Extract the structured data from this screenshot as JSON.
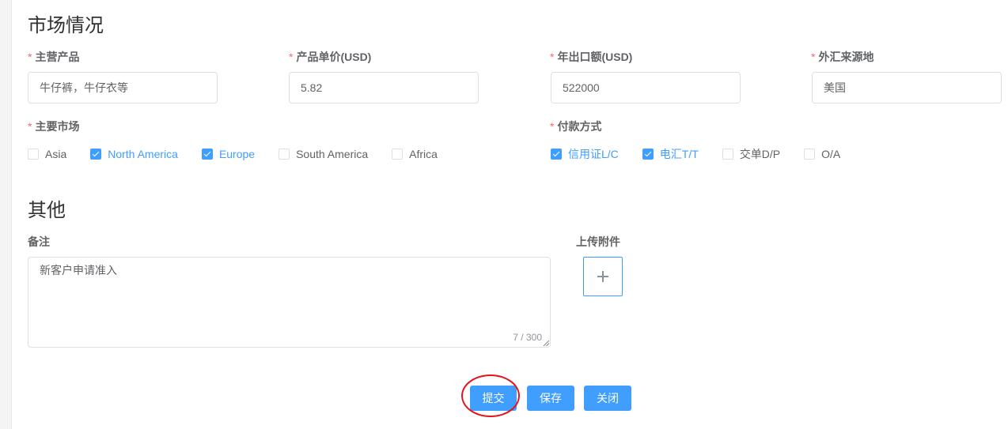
{
  "market": {
    "title": "市场情况",
    "main_product": {
      "label": "主营产品",
      "value": "牛仔裤，牛仔衣等"
    },
    "unit_price": {
      "label": "产品单价(USD)",
      "value": "5.82"
    },
    "annual_export": {
      "label": "年出口额(USD)",
      "value": "522000"
    },
    "fx_source": {
      "label": "外汇来源地",
      "value": "美国"
    },
    "main_markets": {
      "label": "主要市场",
      "options": [
        {
          "label": "Asia",
          "checked": false
        },
        {
          "label": "North America",
          "checked": true
        },
        {
          "label": "Europe",
          "checked": true
        },
        {
          "label": "South America",
          "checked": false
        },
        {
          "label": "Africa",
          "checked": false
        }
      ]
    },
    "payment_methods": {
      "label": "付款方式",
      "options": [
        {
          "label": "信用证L/C",
          "checked": true
        },
        {
          "label": "电汇T/T",
          "checked": true
        },
        {
          "label": "交单D/P",
          "checked": false
        },
        {
          "label": "O/A",
          "checked": false
        }
      ]
    }
  },
  "other": {
    "title": "其他",
    "remarks": {
      "label": "备注",
      "value": "新客户申请准入",
      "counter": "7 / 300"
    },
    "attachment": {
      "label": "上传附件"
    }
  },
  "actions": {
    "submit": "提交",
    "save": "保存",
    "close": "关闭"
  },
  "colors": {
    "primary": "#409eff",
    "required": "#f56c6c",
    "annotation": "#e4141b"
  },
  "icons": {
    "upload": "plus-icon",
    "check": "check-icon",
    "resize": "resize-grip-icon"
  }
}
